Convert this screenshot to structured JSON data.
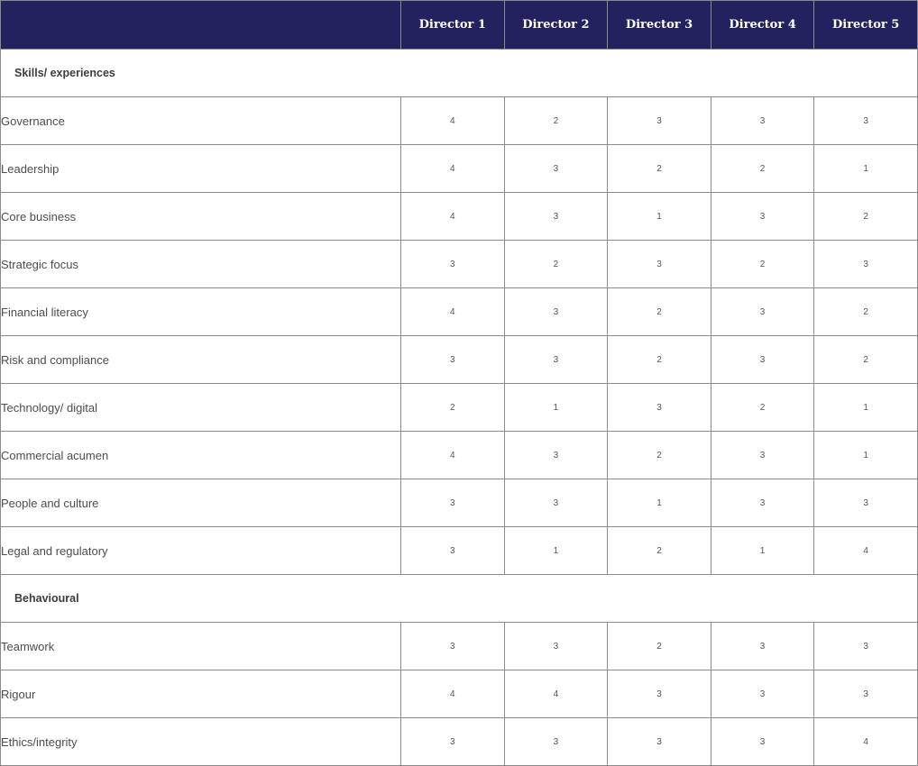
{
  "table": {
    "corner_label": "",
    "columns": [
      "Director 1",
      "Director 2",
      "Director 3",
      "Director 4",
      "Director 5"
    ],
    "sections": [
      {
        "title": "Skills/ experiences",
        "rows": [
          {
            "label": "Governance",
            "scores": [
              "4",
              "2",
              "3",
              "3",
              "3"
            ]
          },
          {
            "label": "Leadership",
            "scores": [
              "4",
              "3",
              "2",
              "2",
              "1"
            ]
          },
          {
            "label": "Core business",
            "scores": [
              "4",
              "3",
              "1",
              "3",
              "2"
            ]
          },
          {
            "label": "Strategic focus",
            "scores": [
              "3",
              "2",
              "3",
              "2",
              "3"
            ]
          },
          {
            "label": "Financial literacy",
            "scores": [
              "4",
              "3",
              "2",
              "3",
              "2"
            ]
          },
          {
            "label": "Risk and compliance",
            "scores": [
              "3",
              "3",
              "2",
              "3",
              "2"
            ]
          },
          {
            "label": "Technology/ digital",
            "scores": [
              "2",
              "1",
              "3",
              "2",
              "1"
            ]
          },
          {
            "label": "Commercial acumen",
            "scores": [
              "4",
              "3",
              "2",
              "3",
              "1"
            ]
          },
          {
            "label": "People and culture",
            "scores": [
              "3",
              "3",
              "1",
              "3",
              "3"
            ]
          },
          {
            "label": "Legal and regulatory",
            "scores": [
              "3",
              "1",
              "2",
              "1",
              "4"
            ]
          }
        ]
      },
      {
        "title": "Behavioural",
        "rows": [
          {
            "label": "Teamwork",
            "scores": [
              "3",
              "3",
              "2",
              "3",
              "3"
            ]
          },
          {
            "label": "Rigour",
            "scores": [
              "4",
              "4",
              "3",
              "3",
              "3"
            ]
          },
          {
            "label": "Ethics/integrity",
            "scores": [
              "3",
              "3",
              "3",
              "3",
              "4"
            ]
          }
        ]
      }
    ]
  },
  "colors": {
    "header_background": "#24215f",
    "header_text": "#ffffff",
    "grid_lines": "#8a8a8a"
  }
}
